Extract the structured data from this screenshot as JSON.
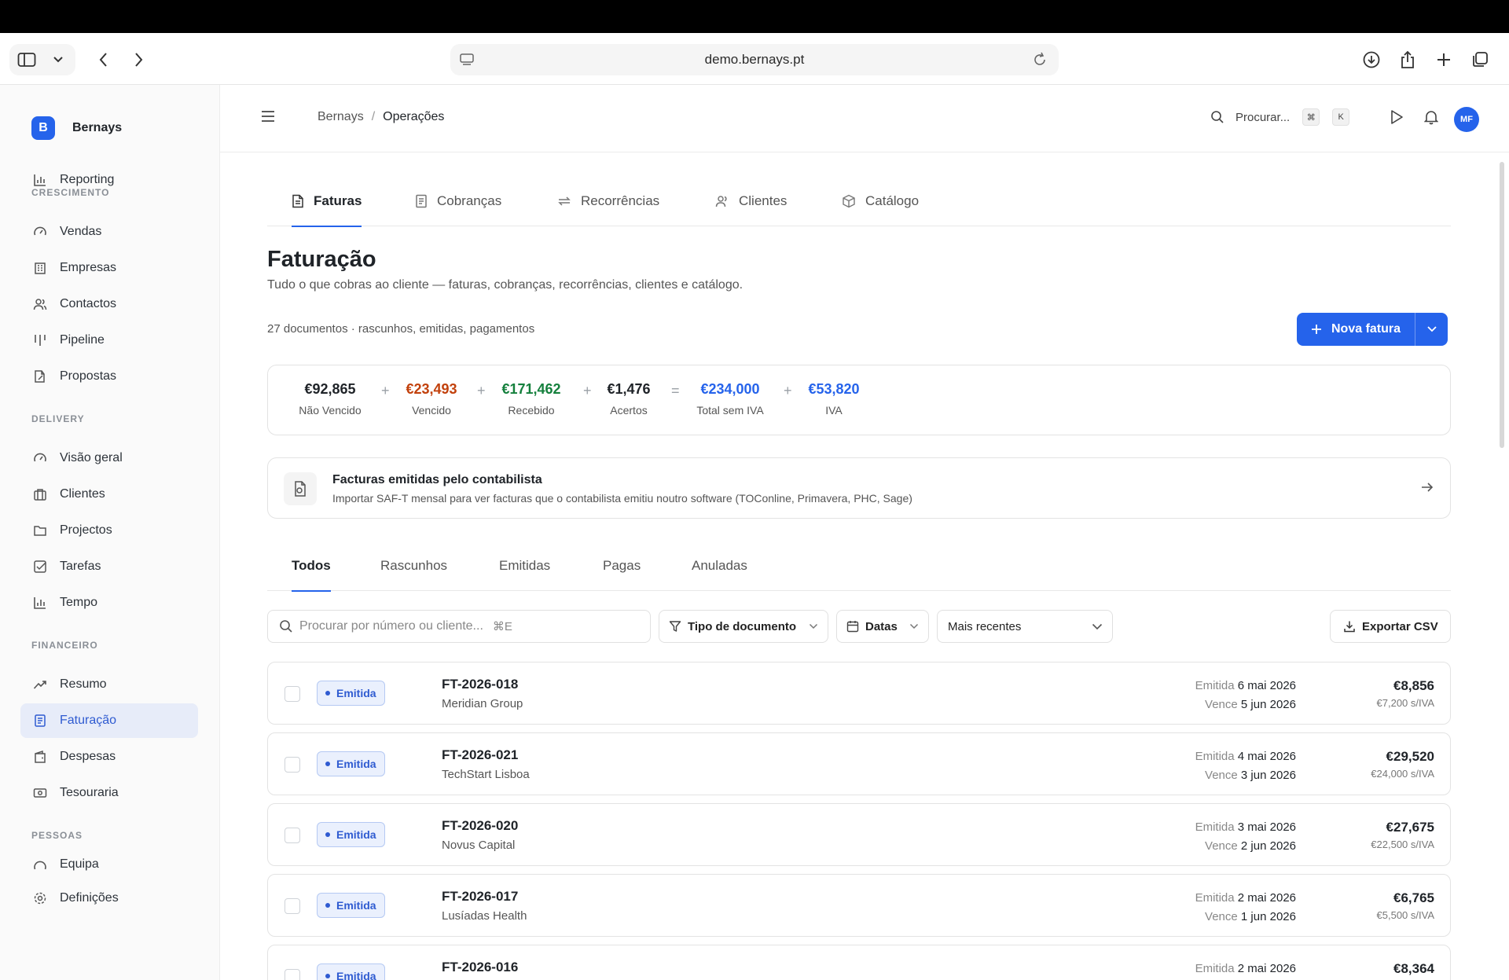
{
  "browser": {
    "url": "demo.bernays.pt"
  },
  "sidebar": {
    "brand": {
      "initial": "B",
      "name": "Bernays"
    },
    "top_item": "Reporting",
    "sections": [
      {
        "label": "CRESCIMENTO",
        "items": [
          "Vendas",
          "Empresas",
          "Contactos",
          "Pipeline",
          "Propostas"
        ]
      },
      {
        "label": "DELIVERY",
        "items": [
          "Visão geral",
          "Clientes",
          "Projectos",
          "Tarefas",
          "Tempo"
        ]
      },
      {
        "label": "FINANCEIRO",
        "items": [
          "Resumo",
          "Faturação",
          "Despesas",
          "Tesouraria"
        ]
      },
      {
        "label": "PESSOAS",
        "items": [
          "Equipa"
        ]
      }
    ],
    "active": "Faturação",
    "bottom_item": "Definições"
  },
  "header": {
    "breadcrumb": [
      "Bernays",
      "Operações"
    ],
    "separator": "/",
    "search_label": "Procurar...",
    "kbd": [
      "⌘",
      "K"
    ],
    "avatar": "MF"
  },
  "tabs": [
    "Faturas",
    "Cobranças",
    "Recorrências",
    "Clientes",
    "Catálogo"
  ],
  "active_tab": "Faturas",
  "page": {
    "title": "Faturação",
    "subtitle": "Tudo o que cobras ao cliente — faturas, cobranças, recorrências, clientes e catálogo.",
    "doc_count": "27 documentos · rascunhos, emitidas, pagamentos",
    "new_button": "Nova fatura"
  },
  "summary": {
    "items": [
      {
        "value": "€92,865",
        "label": "Não Vencido",
        "color": "#1f2328"
      },
      {
        "value": "€23,493",
        "label": "Vencido",
        "color": "#c2410c"
      },
      {
        "value": "€171,462",
        "label": "Recebido",
        "color": "#15803d"
      },
      {
        "value": "€1,476",
        "label": "Acertos",
        "color": "#1f2328"
      },
      {
        "value": "€234,000",
        "label": "Total sem IVA",
        "color": "#2563eb"
      },
      {
        "value": "€53,820",
        "label": "IVA",
        "color": "#2563eb"
      }
    ],
    "operators": [
      "+",
      "+",
      "+",
      "=",
      "+"
    ]
  },
  "saft_card": {
    "title": "Facturas emitidas pelo contabilista",
    "description": "Importar SAF-T mensal para ver facturas que o contabilista emitiu noutro software (TOConline, Primavera, PHC, Sage)"
  },
  "status_tabs": [
    "Todos",
    "Rascunhos",
    "Emitidas",
    "Pagas",
    "Anuladas"
  ],
  "active_status_tab": "Todos",
  "filters": {
    "search_placeholder": "Procurar por número ou cliente...",
    "search_shortcut": "⌘E",
    "doc_type": "Tipo de documento",
    "dates": "Datas",
    "sort": "Mais recentes",
    "export": "Exportar CSV"
  },
  "invoices": [
    {
      "status": "Emitida",
      "number": "FT-2026-018",
      "client": "Meridian Group",
      "issued_label": "Emitida",
      "issued": "6 mai 2026",
      "due_label": "Vence",
      "due": "5 jun 2026",
      "amount": "€8,856",
      "net": "€7,200 s/IVA"
    },
    {
      "status": "Emitida",
      "number": "FT-2026-021",
      "client": "TechStart Lisboa",
      "issued_label": "Emitida",
      "issued": "4 mai 2026",
      "due_label": "Vence",
      "due": "3 jun 2026",
      "amount": "€29,520",
      "net": "€24,000 s/IVA"
    },
    {
      "status": "Emitida",
      "number": "FT-2026-020",
      "client": "Novus Capital",
      "issued_label": "Emitida",
      "issued": "3 mai 2026",
      "due_label": "Vence",
      "due": "2 jun 2026",
      "amount": "€27,675",
      "net": "€22,500 s/IVA"
    },
    {
      "status": "Emitida",
      "number": "FT-2026-017",
      "client": "Lusíadas Health",
      "issued_label": "Emitida",
      "issued": "2 mai 2026",
      "due_label": "Vence",
      "due": "1 jun 2026",
      "amount": "€6,765",
      "net": "€5,500 s/IVA"
    },
    {
      "status": "Emitida",
      "number": "FT-2026-016",
      "client": "",
      "issued_label": "Emitida",
      "issued": "2 mai 2026",
      "due_label": "",
      "due": "",
      "amount": "€8,364",
      "net": ""
    }
  ],
  "icons": {
    "sidebar_toggle": "sidebar-icon",
    "back": "chevron-left-icon",
    "forward": "chevron-right-icon",
    "reload": "reload-icon",
    "download": "download-icon",
    "share": "share-icon",
    "new_tab": "plus-icon",
    "tabs": "tabs-icon",
    "search": "search-icon",
    "play": "play-icon",
    "bell": "bell-icon",
    "menu": "menu-icon"
  },
  "colors": {
    "accent": "#2563eb",
    "active_bg": "#e7ecf9",
    "overdue": "#c2410c",
    "received": "#15803d"
  }
}
